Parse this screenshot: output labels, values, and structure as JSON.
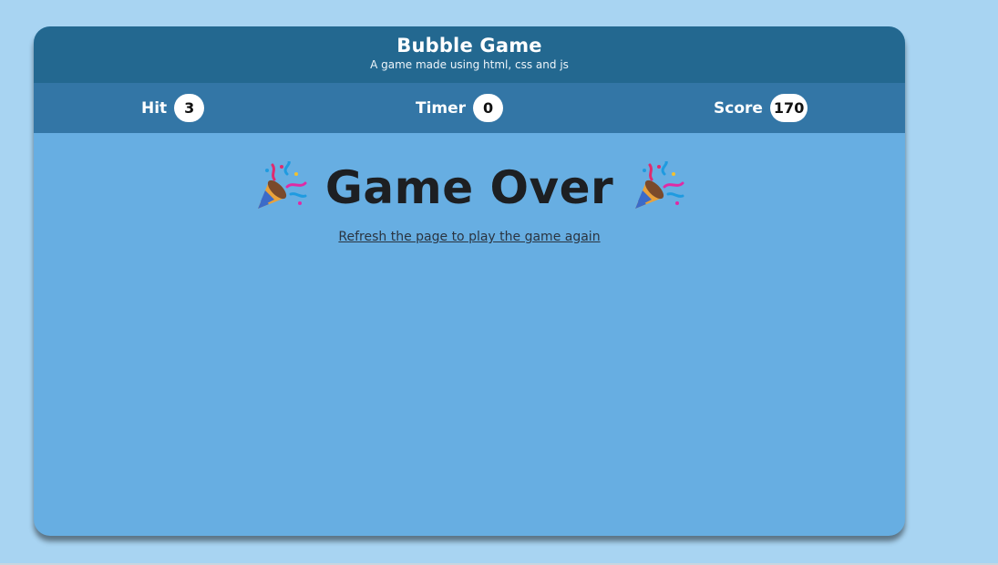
{
  "header": {
    "title": "Bubble Game",
    "subtitle": "A game made using html, css and js"
  },
  "stats": {
    "hit_label": "Hit",
    "hit_value": "3",
    "timer_label": "Timer",
    "timer_value": "0",
    "score_label": "Score",
    "score_value": "170"
  },
  "game_over": {
    "text": "Game Over",
    "left_icon": "party-popper-icon",
    "right_icon": "party-popper-icon",
    "refresh_link": "Refresh the page to play the game again"
  },
  "colors": {
    "page_background": "#a8d4f2",
    "header": "#236890",
    "stats_bar": "#3376a6",
    "play_area": "#67aee2"
  }
}
